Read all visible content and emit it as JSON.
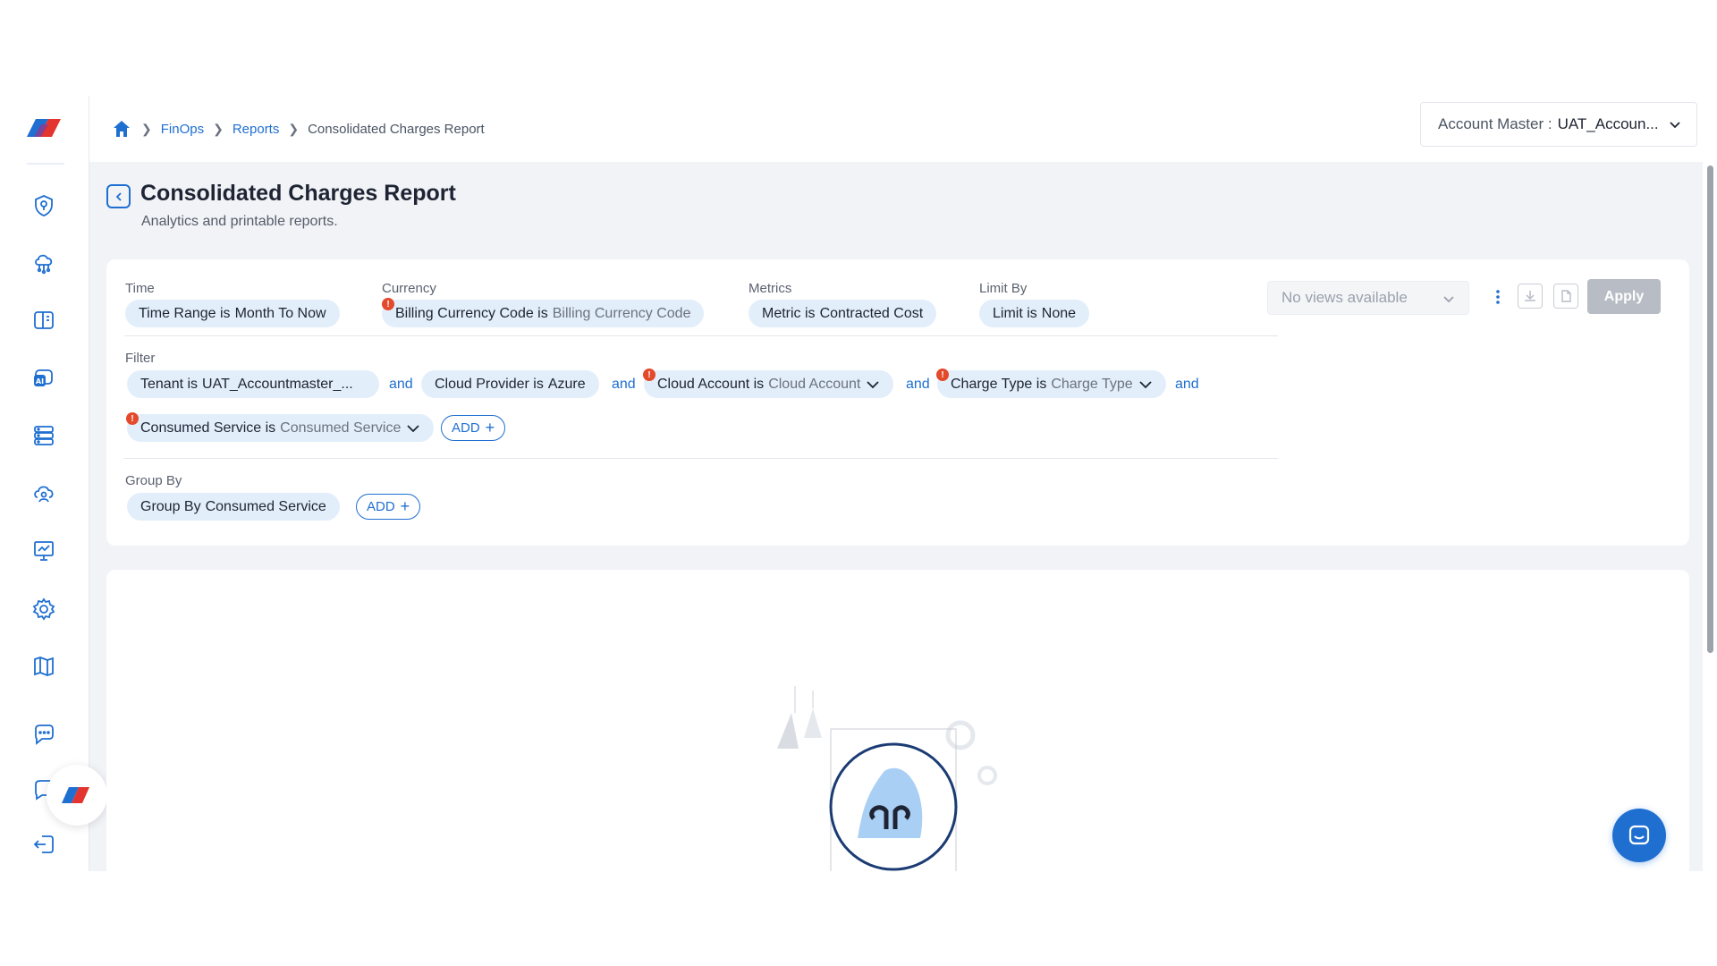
{
  "colors": {
    "accent": "#1f6fd1",
    "chip_bg": "#e3eefb",
    "warning": "#e34a2b",
    "apply_disabled": "#b7bcc5"
  },
  "sidebar": {
    "icons": [
      "location-shield-icon",
      "cloud-network-icon",
      "panels-icon",
      "ai-chat-icon",
      "server-list-icon",
      "cloud-people-icon",
      "presentation-chart-icon",
      "settings-gear-icon",
      "map-book-icon",
      "chat-dots-icon",
      "person-chat-icon",
      "logout-icon"
    ]
  },
  "breadcrumb": {
    "items": [
      "FinOps",
      "Reports"
    ],
    "current": "Consolidated Charges Report"
  },
  "account": {
    "label": "Account Master :",
    "value": "UAT_Accoun..."
  },
  "page": {
    "title": "Consolidated Charges Report",
    "subtitle": "Analytics and printable reports."
  },
  "sections": {
    "time": "Time",
    "currency": "Currency",
    "metrics": "Metrics",
    "limit": "Limit By",
    "filter": "Filter",
    "group": "Group By"
  },
  "chips": {
    "time": {
      "key": "Time Range is",
      "value": "Month To Now"
    },
    "currency": {
      "key": "Billing Currency Code is",
      "value": "Billing Currency Code"
    },
    "metric": {
      "key": "Metric is",
      "value": "Contracted Cost"
    },
    "limit": {
      "key": "Limit is",
      "value": "None"
    },
    "tenant": {
      "key": "Tenant is",
      "value": "UAT_Accountmaster_..."
    },
    "provider": {
      "key": "Cloud Provider is",
      "value": "Azure"
    },
    "account": {
      "key": "Cloud Account is",
      "value": "Cloud Account"
    },
    "charge": {
      "key": "Charge Type is",
      "value": "Charge Type"
    },
    "service": {
      "key": "Consumed Service is",
      "value": "Consumed Service"
    },
    "group": {
      "key": "Group By",
      "value": "Consumed Service"
    }
  },
  "and_label": "and",
  "add_label": "ADD",
  "views": {
    "placeholder": "No views available"
  },
  "apply_label": "Apply"
}
